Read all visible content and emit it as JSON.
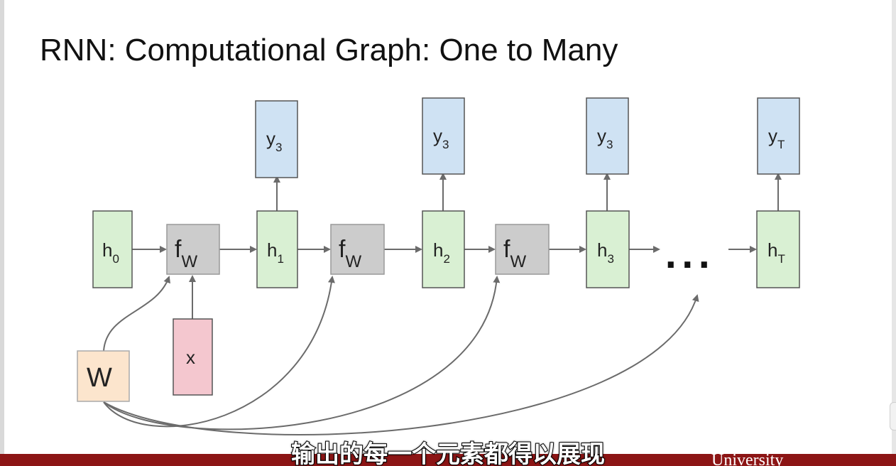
{
  "slide": {
    "title": "RNN: Computational Graph: One to Many"
  },
  "diagram": {
    "hidden_states": [
      {
        "main": "h",
        "sub": "0"
      },
      {
        "main": "h",
        "sub": "1"
      },
      {
        "main": "h",
        "sub": "2"
      },
      {
        "main": "h",
        "sub": "3"
      },
      {
        "main": "h",
        "sub": "T"
      }
    ],
    "functions": [
      {
        "main": "f",
        "sub": "W"
      },
      {
        "main": "f",
        "sub": "W"
      },
      {
        "main": "f",
        "sub": "W"
      }
    ],
    "outputs": [
      {
        "main": "y",
        "sub": "3"
      },
      {
        "main": "y",
        "sub": "3"
      },
      {
        "main": "y",
        "sub": "3"
      },
      {
        "main": "y",
        "sub": "T"
      }
    ],
    "input": {
      "main": "x"
    },
    "weight": {
      "main": "W"
    },
    "ellipsis": "...",
    "colors": {
      "hidden_fill": "#d9f0d3",
      "function_fill": "#cccccc",
      "output_fill": "#cfe2f3",
      "input_fill": "#f4c7cf",
      "weight_fill": "#fce5cd",
      "stroke": "#555555",
      "arrow": "#6b6b6b"
    }
  },
  "subtitle": "输出的每一个元素都得以展现",
  "footer": {
    "brand_fragment": "University",
    "bar_color": "#8c1515"
  }
}
